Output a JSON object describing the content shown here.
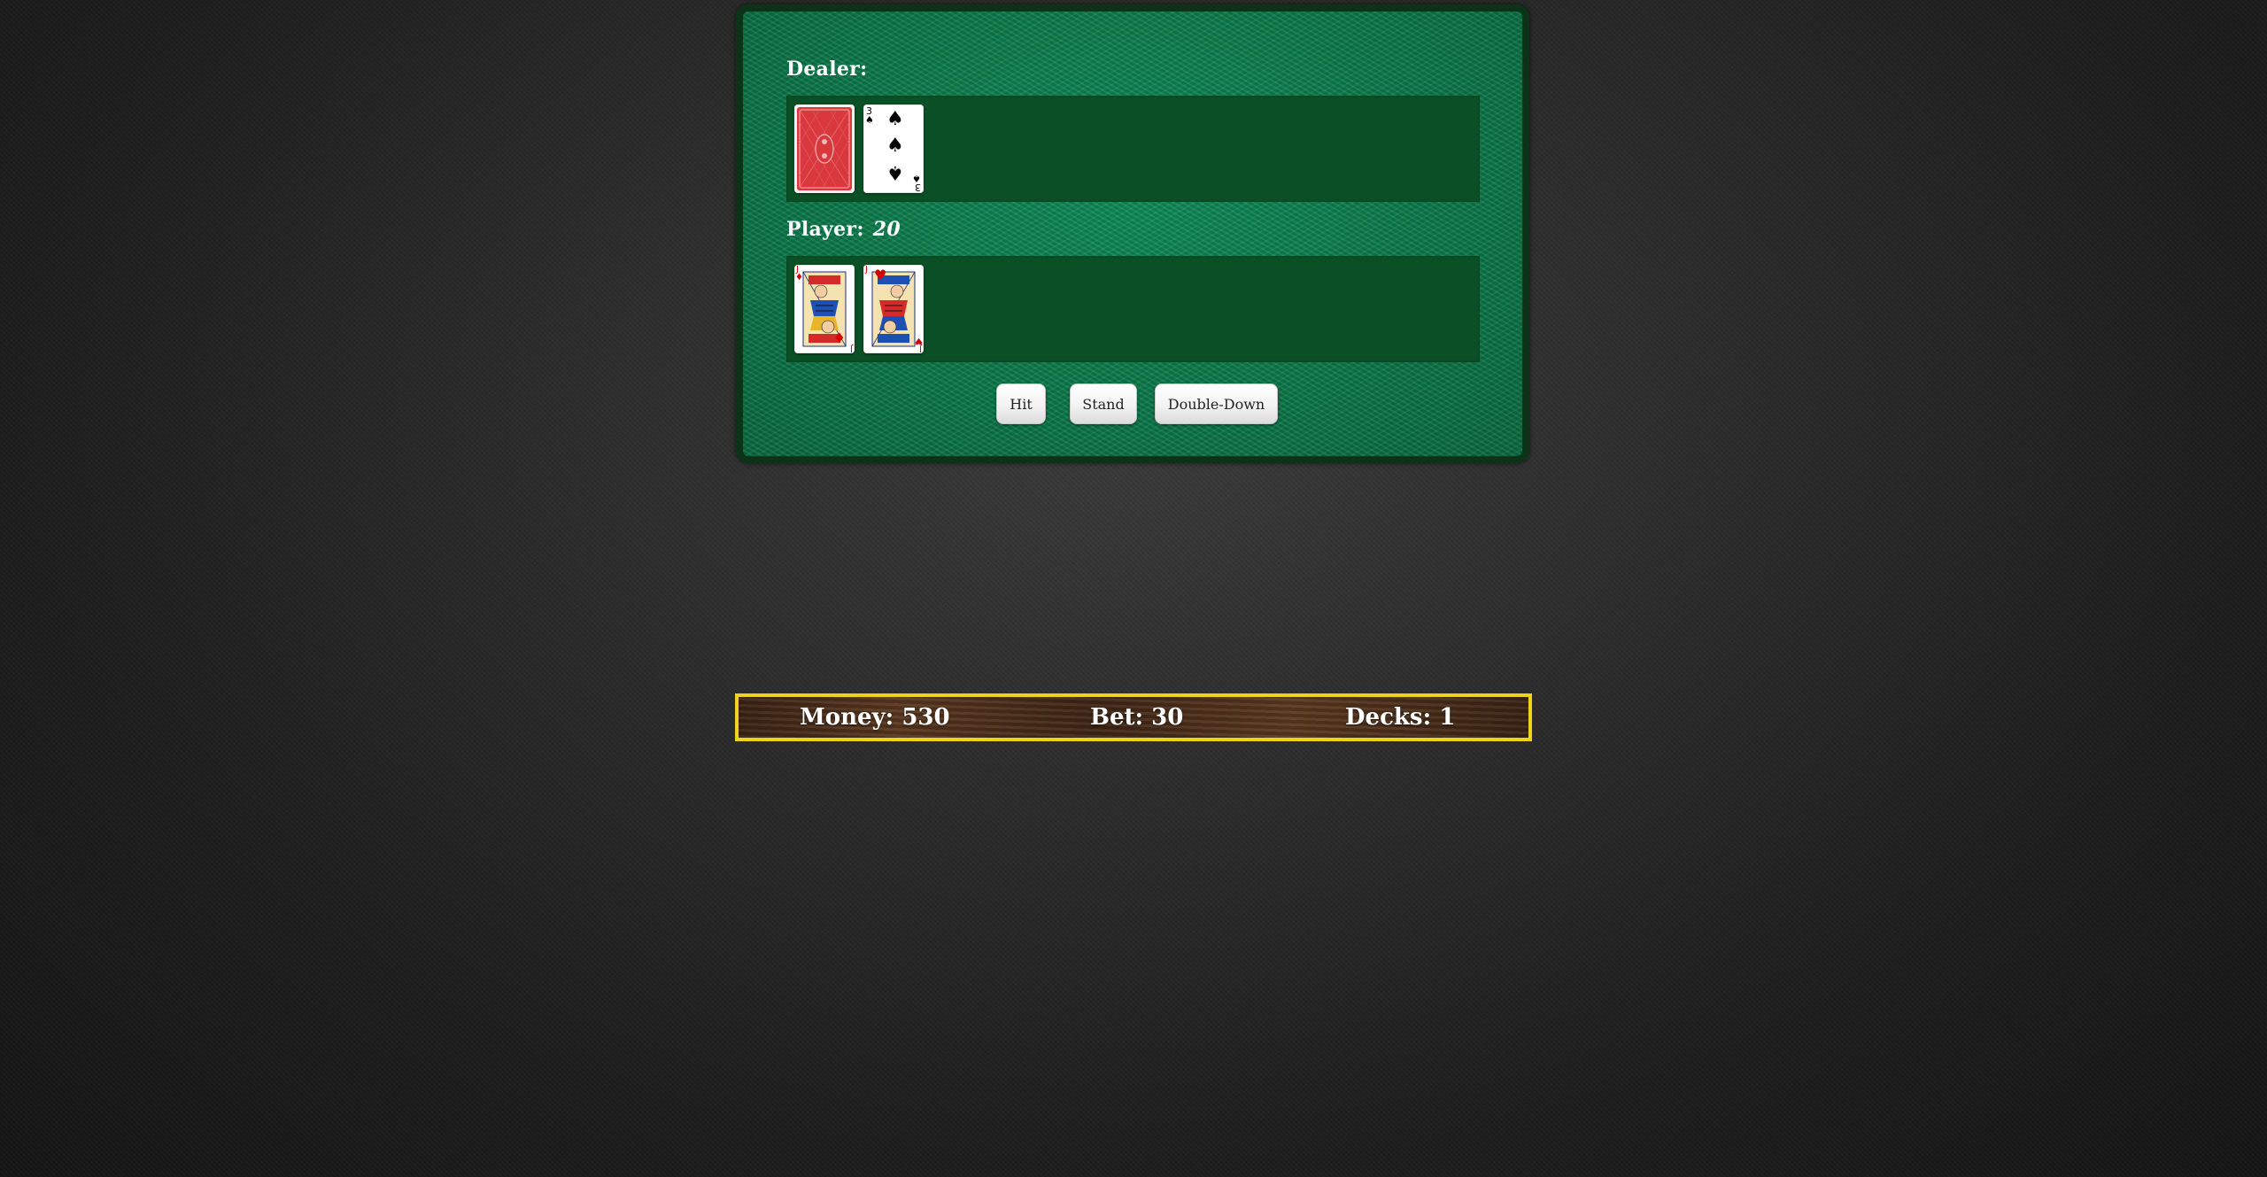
{
  "dealer": {
    "label": "Dealer:",
    "cards": [
      {
        "face_down": true
      },
      {
        "rank": "3",
        "suit": "spades",
        "symbol": "♠",
        "color": "#000000"
      }
    ]
  },
  "player": {
    "label": "Player:",
    "score": "20",
    "cards": [
      {
        "rank": "J",
        "suit": "diamonds",
        "symbol": "♦",
        "color": "#d40000"
      },
      {
        "rank": "J",
        "suit": "hearts",
        "symbol": "♥",
        "color": "#d40000"
      }
    ]
  },
  "actions": {
    "hit": "Hit",
    "stand": "Stand",
    "double_down": "Double-Down"
  },
  "status": {
    "money": "Money: 530",
    "bet": "Bet: 30",
    "decks": "Decks: 1"
  },
  "colors": {
    "felt": "#0b7a4a",
    "felt_border": "#0c3318",
    "hand_area": "#0a4f26",
    "status_border": "#f1d21b",
    "card_back": "#d9383c"
  }
}
